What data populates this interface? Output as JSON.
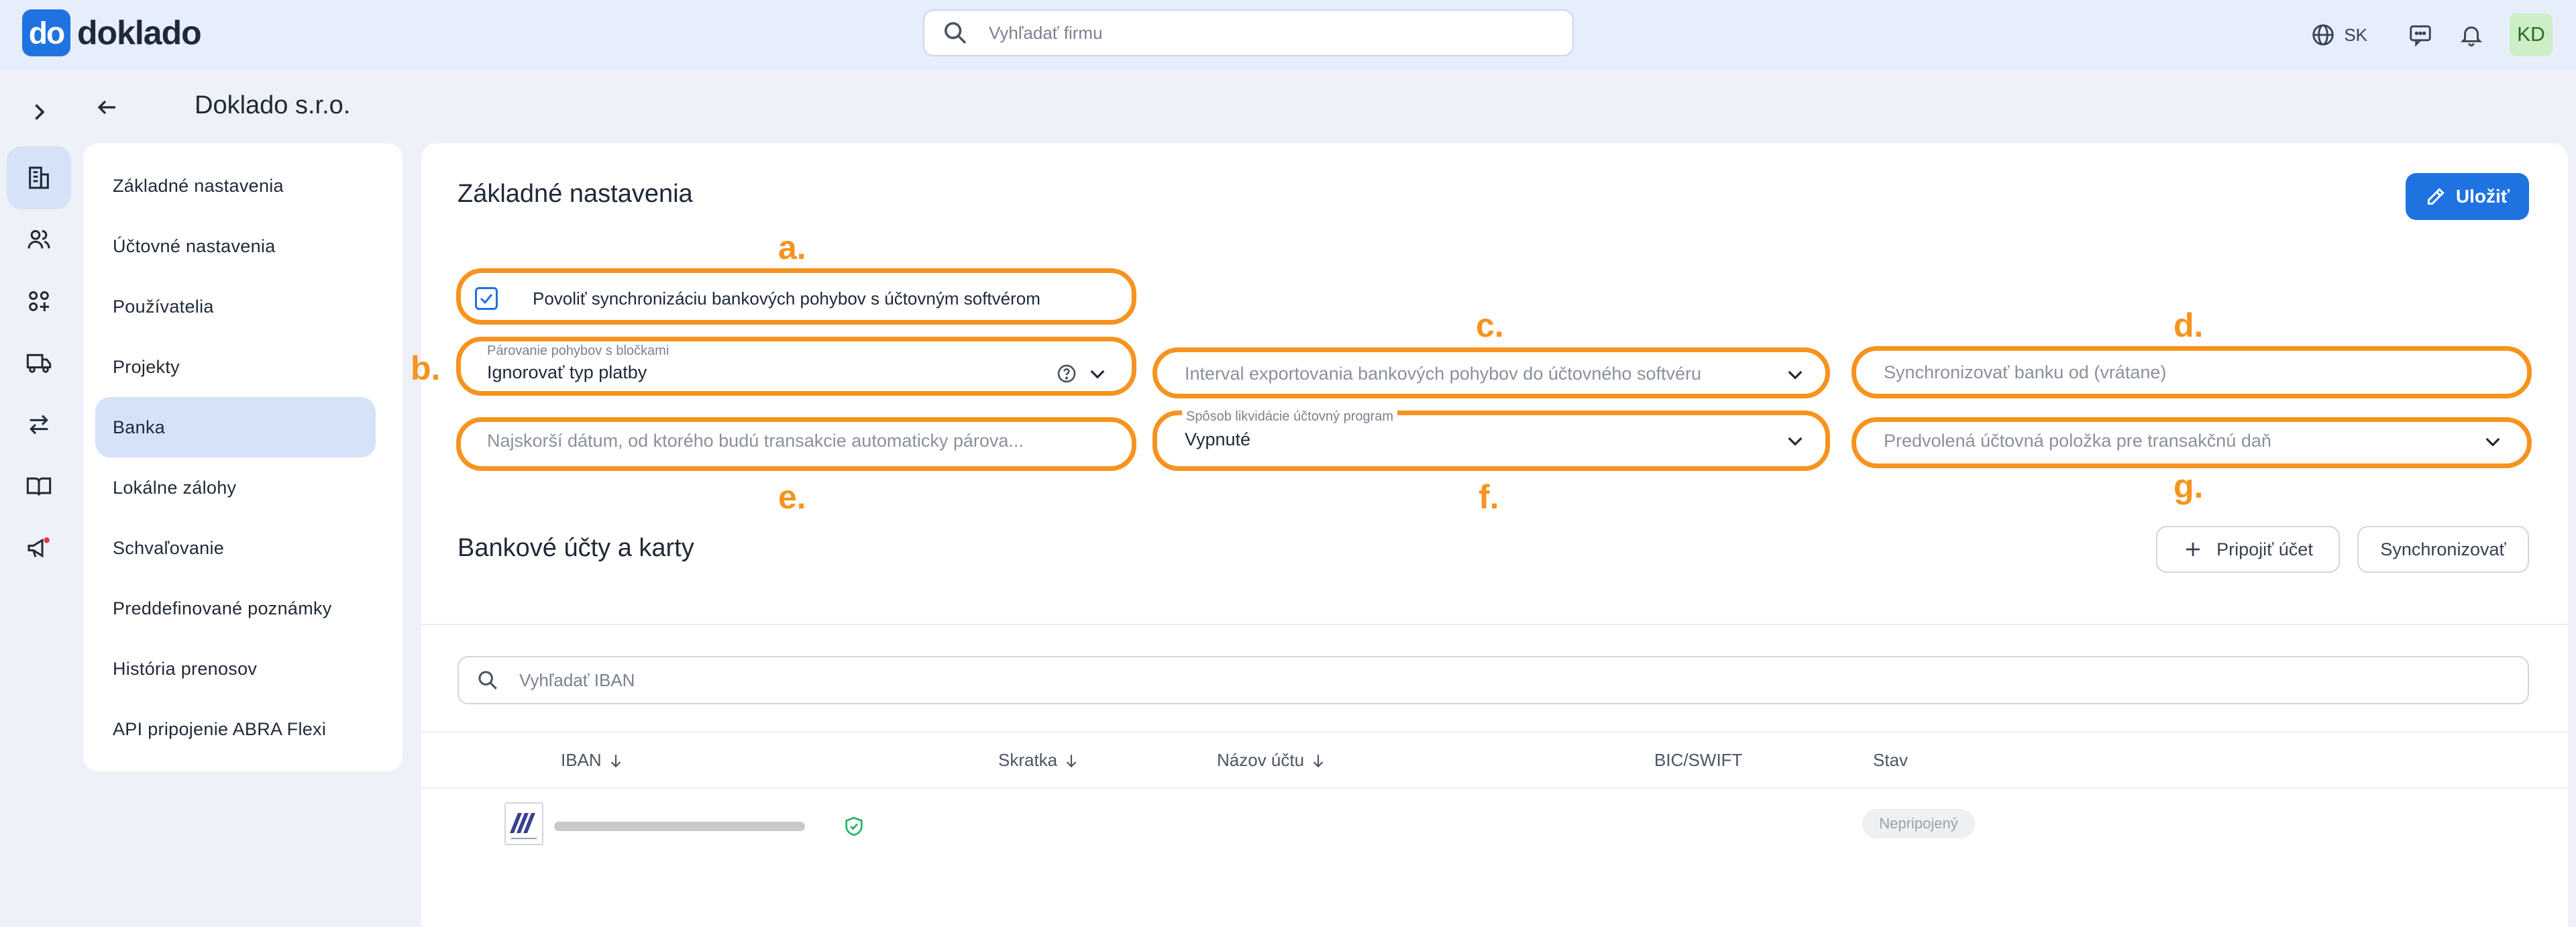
{
  "app": {
    "logo_mark": "do",
    "logo_text": "doklado"
  },
  "topbar": {
    "search_placeholder": "Vyhľadať firmu",
    "language": "SK",
    "user_initials": "KD",
    "icons": [
      "search-icon",
      "globe-icon",
      "chat-icon",
      "bell-icon"
    ]
  },
  "rail": {
    "icons": [
      "expand-chevron-icon",
      "building-icon",
      "users-icon",
      "apps-icon",
      "truck-icon",
      "transfer-icon",
      "book-icon",
      "megaphone-icon"
    ],
    "active": "building-icon",
    "notification_dot_color": "#e53935"
  },
  "header": {
    "company_name": "Doklado s.r.o."
  },
  "nav": {
    "items": [
      {
        "label": "Základné nastavenia"
      },
      {
        "label": "Účtovné nastavenia"
      },
      {
        "label": "Používatelia"
      },
      {
        "label": "Projekty"
      },
      {
        "label": "Banka"
      },
      {
        "label": "Lokálne zálohy"
      },
      {
        "label": "Schvaľovanie"
      },
      {
        "label": "Preddefinované poznámky"
      },
      {
        "label": "História prenosov"
      },
      {
        "label": "API pripojenie ABRA Flexi"
      }
    ],
    "active": "Banka"
  },
  "settings": {
    "title": "Základné nastavenia",
    "save_label": "Uložiť",
    "sync_checkbox": {
      "label": "Povoliť synchronizáciu bankových pohybov s účtovným softvérom",
      "checked": true
    },
    "fields": {
      "pairing_label": "Párovanie pohybov s bločkami",
      "pairing_value": "Ignorovať typ platby",
      "export_interval_placeholder": "Interval exportovania bankových pohybov do účtovného softvéru",
      "sync_from_placeholder": "Synchronizovať banku od (vrátane)",
      "earliest_date_placeholder": "Najskorší dátum, od ktorého budú transakcie automaticky párova...",
      "liquidation_label": "Spôsob likvidácie účtovný program",
      "liquidation_value": "Vypnuté",
      "default_item_placeholder": "Predvolená účtovná položka pre transakčnú daň"
    }
  },
  "annotations": {
    "a": "a.",
    "b": "b.",
    "c": "c.",
    "d": "d.",
    "e": "e.",
    "f": "f.",
    "g": "g.",
    "color": "#f7931e"
  },
  "accounts": {
    "title": "Bankové účty a karty",
    "connect_label": "Pripojiť účet",
    "sync_label": "Synchronizovať",
    "iban_search_placeholder": "Vyhľadať IBAN",
    "columns": [
      "IBAN",
      "Skratka",
      "Názov účtu",
      "BIC/SWIFT",
      "Stav"
    ],
    "rows": [
      {
        "status": "Nepripojený",
        "secure": true
      }
    ]
  },
  "colors": {
    "primary": "#1f73e0",
    "nav_active": "#d6e2f7",
    "avatar_bg": "#cdeec6",
    "secure_icon": "#2fb36b"
  }
}
